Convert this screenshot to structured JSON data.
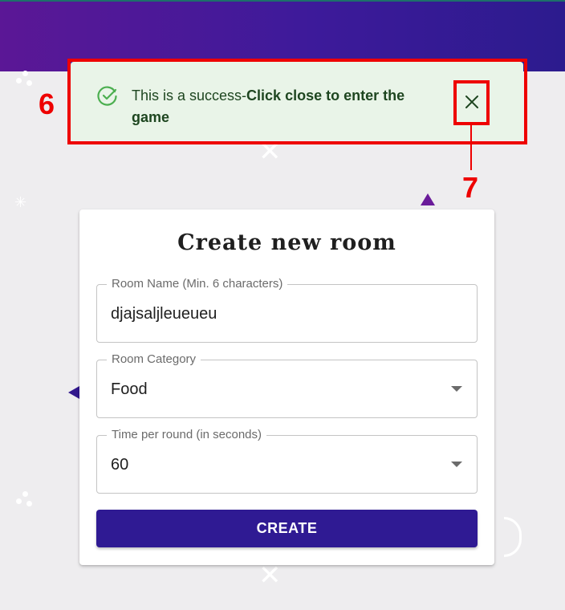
{
  "alert": {
    "message_prefix": "This is a success-",
    "message_bold": "Click close to enter the game",
    "icon": "check-circle-icon",
    "close_icon": "close-icon",
    "color": "#1e4620",
    "background": "#e9f4e8"
  },
  "annotations": [
    {
      "number": "6",
      "target": "success-alert"
    },
    {
      "number": "7",
      "target": "alert-close-button"
    }
  ],
  "form": {
    "title": "Create new room",
    "room_name": {
      "label": "Room Name (Min. 6 characters)",
      "value": "djajsaljleueueu"
    },
    "room_category": {
      "label": "Room Category",
      "value": "Food"
    },
    "time_per_round": {
      "label": "Time per round (in seconds)",
      "value": "60"
    },
    "create_label": "CREATE"
  },
  "colors": {
    "header_gradient_start": "#5b1796",
    "header_gradient_end": "#2c1b8e",
    "button": "#2f1a93",
    "annotation": "#ee0000"
  }
}
